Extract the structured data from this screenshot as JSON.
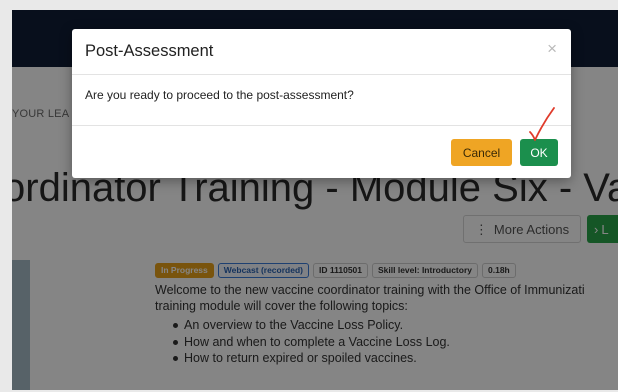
{
  "background": {
    "breadcrumb": "YOUR LEA",
    "page_title": "ordinator Training - Module Six - Vaccine",
    "actions": {
      "more_actions_icon": "vertical-dots-icon",
      "more_actions_label": "More Actions",
      "launch_icon": "chevron-right-icon",
      "launch_label": "L"
    },
    "badges": [
      "In Progress",
      "Webcast (recorded)",
      "ID 1110501",
      "Skill level: Introductory",
      "0.18h"
    ],
    "description": {
      "line1": "Welcome to the new vaccine coordinator training with the Office of Immunizati",
      "line2": "training module will cover the following topics:",
      "topics": [
        "An overview to the Vaccine Loss Policy.",
        "How and when to complete a Vaccine Loss Log.",
        "How to return expired or spoiled vaccines."
      ]
    }
  },
  "modal": {
    "title": "Post-Assessment",
    "close_symbol": "×",
    "body": "Are you ready to proceed to the post-assessment?",
    "cancel_label": "Cancel",
    "ok_label": "OK"
  },
  "annotation": {
    "icon": "checkmark-icon",
    "color": "#e03b2b"
  },
  "colors": {
    "topbar": "#101e36",
    "cancel": "#efa524",
    "ok": "#1b8f4d",
    "in_progress": "#e9a21a",
    "launch": "#29a64a"
  }
}
